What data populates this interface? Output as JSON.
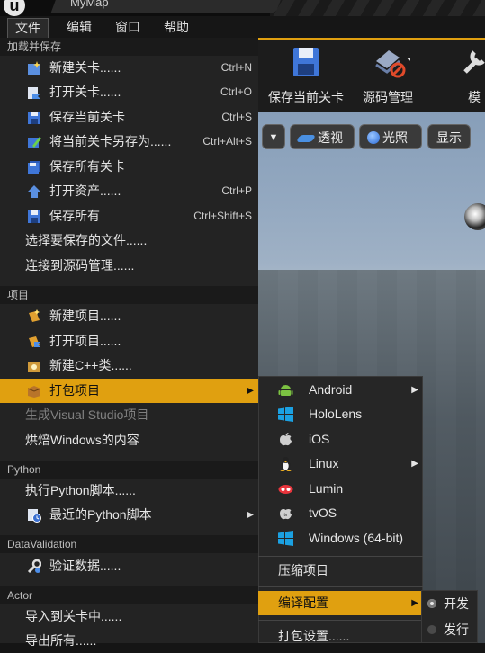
{
  "window": {
    "title": "MyMap",
    "logo": "u"
  },
  "menubar": [
    "文件",
    "编辑",
    "窗口",
    "帮助"
  ],
  "toolbar": [
    {
      "label": "保存当前关卡",
      "icon": "floppy-disk-icon"
    },
    {
      "label": "源码管理",
      "icon": "source-control-icon"
    },
    {
      "label": "模",
      "icon": "wrench-icon"
    }
  ],
  "viewport_buttons": [
    "透视",
    "光照",
    "显示"
  ],
  "file_menu": {
    "sections": [
      {
        "title": "加载并保存",
        "items": [
          {
            "label": "新建关卡......",
            "shortcut": "Ctrl+N",
            "icon": "new-level-icon"
          },
          {
            "label": "打开关卡......",
            "shortcut": "Ctrl+O",
            "icon": "open-level-icon"
          },
          {
            "label": "保存当前关卡",
            "shortcut": "Ctrl+S",
            "icon": "save-icon"
          },
          {
            "label": "将当前关卡另存为......",
            "shortcut": "Ctrl+Alt+S",
            "icon": "save-as-icon"
          },
          {
            "label": "保存所有关卡",
            "shortcut": "",
            "icon": "save-all-levels-icon"
          },
          {
            "label": "打开资产......",
            "shortcut": "Ctrl+P",
            "icon": "open-asset-icon"
          },
          {
            "label": "保存所有",
            "shortcut": "Ctrl+Shift+S",
            "icon": "save-all-icon"
          },
          {
            "label": "选择要保存的文件......",
            "shortcut": ""
          },
          {
            "label": "连接到源码管理......",
            "shortcut": ""
          }
        ]
      },
      {
        "title": "项目",
        "items": [
          {
            "label": "新建项目......",
            "icon": "new-project-icon"
          },
          {
            "label": "打开项目......",
            "icon": "open-project-icon"
          },
          {
            "label": "新建C++类......",
            "icon": "new-cpp-class-icon"
          },
          {
            "label": "打包项目",
            "icon": "package-icon",
            "submenu": true
          },
          {
            "label": "生成Visual Studio项目",
            "disabled": true
          },
          {
            "label": "烘焙Windows的内容"
          }
        ]
      },
      {
        "title": "Python",
        "items": [
          {
            "label": "执行Python脚本......"
          },
          {
            "label": "最近的Python脚本",
            "icon": "recent-scripts-icon",
            "submenu": true
          }
        ]
      },
      {
        "title": "DataValidation",
        "items": [
          {
            "label": "验证数据......",
            "icon": "validate-data-icon"
          }
        ]
      },
      {
        "title": "Actor",
        "items": [
          {
            "label": "导入到关卡中......"
          },
          {
            "label": "导出所有......"
          }
        ]
      }
    ]
  },
  "package_submenu": {
    "platforms": [
      {
        "label": "Android",
        "icon": "android-icon",
        "submenu": true
      },
      {
        "label": "HoloLens",
        "icon": "windows-icon"
      },
      {
        "label": "iOS",
        "icon": "apple-icon"
      },
      {
        "label": "Linux",
        "icon": "linux-icon",
        "submenu": true
      },
      {
        "label": "Lumin",
        "icon": "lumin-icon"
      },
      {
        "label": "tvOS",
        "icon": "tvos-icon"
      },
      {
        "label": "Windows (64-bit)",
        "icon": "windows-icon"
      }
    ],
    "zip_project": "压缩项目",
    "build_config": "编译配置",
    "package_settings": "打包设置......"
  },
  "build_config_submenu": [
    {
      "label": "开发",
      "selected": true
    },
    {
      "label": "发行",
      "selected": false
    }
  ],
  "colors": {
    "accent": "#e0a010",
    "menu_bg": "#232323",
    "section_bg": "#1a1a1a"
  }
}
